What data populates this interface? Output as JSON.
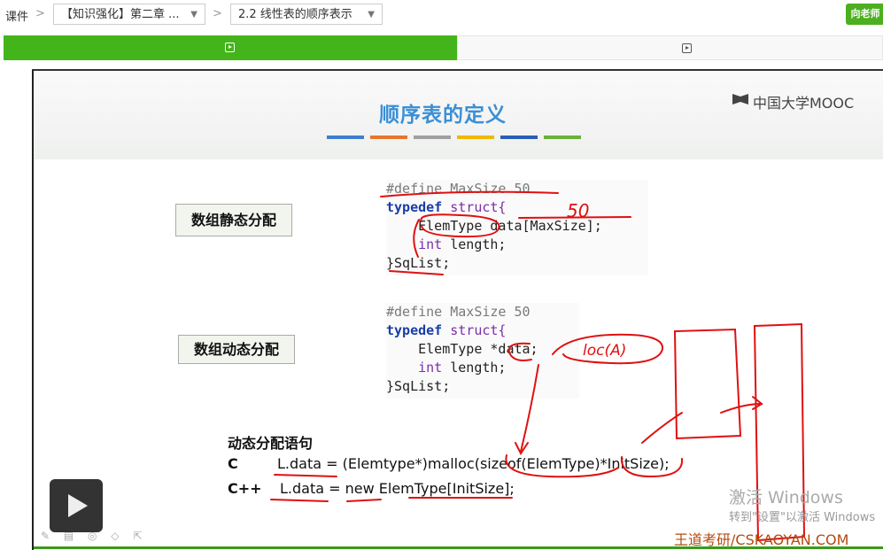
{
  "breadcrumb": {
    "root": "课件",
    "chapter": "【知识强化】第二章 ...",
    "lesson": "2.2 线性表的顺序表示"
  },
  "ask_teacher": "向老师",
  "slide": {
    "title": "顺序表的定义",
    "logo": "中国大学MOOC",
    "bar_colors": [
      "#3d7fd0",
      "#e8762a",
      "#a0a0a0",
      "#f0b800",
      "#2a5db8",
      "#6ab03a"
    ],
    "static_label": "数组静态分配",
    "dynamic_label": "数组动态分配",
    "code_static": {
      "line1_pp": "#define MaxSize 50",
      "line2_kw": "typedef",
      "line2_rest": " struct{",
      "line3_type": "    ElemType data[MaxSize];",
      "line4_kw": "int",
      "line4_rest": " length;",
      "line5": "}SqList;"
    },
    "code_dynamic": {
      "line1_pp": "#define MaxSize 50",
      "line2_kw": "typedef",
      "line2_rest": " struct{",
      "line3": "    ElemType *data;",
      "line4_kw": "int",
      "line4_rest": " length;",
      "line5": "}SqList;"
    },
    "stmt_heading": "动态分配语句",
    "c_label": "C",
    "c_stmt": "L.data = (Elemtype*)malloc(sizeof(ElemType)*InitSize);",
    "cpp_label": "C++",
    "cpp_stmt": "L.data = new ElemType[InitSize];",
    "credit": "王道考研/CSKAOYAN.COM",
    "handwriting_50": "50",
    "handwriting_loc": "loc(A)"
  },
  "watermark": {
    "line1": "激活 Windows",
    "line2": "转到\"设置\"以激活 Windows"
  },
  "tools": "✎ ▤ ◎ ◇ ⇱"
}
